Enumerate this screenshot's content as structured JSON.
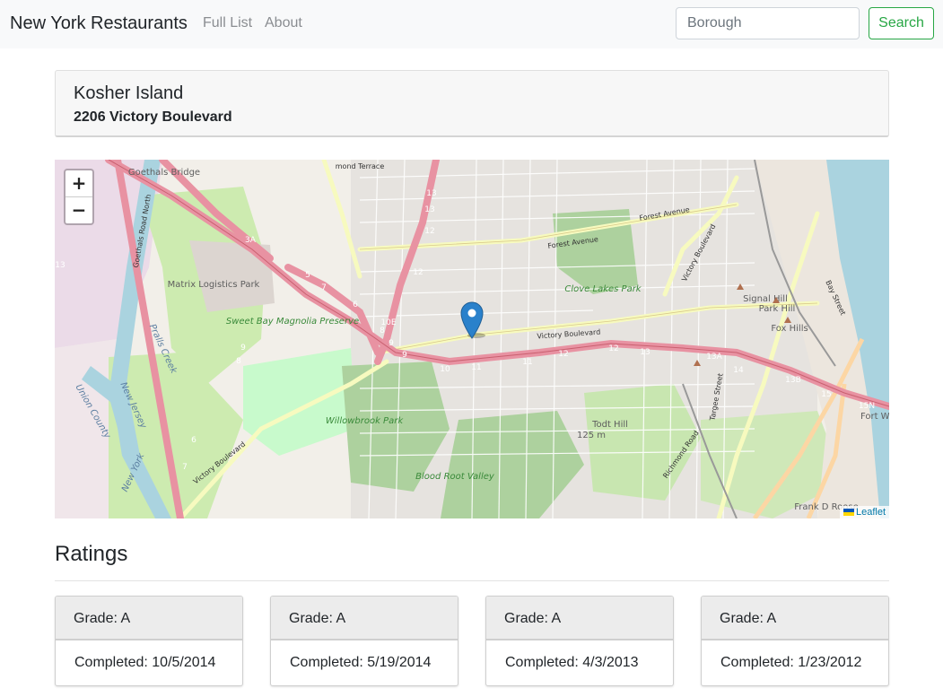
{
  "navbar": {
    "brand": "New York Restaurants",
    "links": [
      "Full List",
      "About"
    ],
    "search": {
      "placeholder": "Borough",
      "value": ""
    },
    "search_button": "Search"
  },
  "restaurant": {
    "name": "Kosher Island",
    "address": "2206 Victory Boulevard"
  },
  "map": {
    "zoom_in": "+",
    "zoom_out": "−",
    "attribution": "Leaflet",
    "labels": {
      "goethals_bridge": "Goethals Bridge",
      "matrix_park": "Matrix Logistics Park",
      "sweet_bay": "Sweet Bay Magnolia Preserve",
      "clove_lakes": "Clove Lakes Park",
      "signal_hill": "Signal Hill",
      "park_hill": "Park Hill",
      "fox_hills": "Fox Hills",
      "willowbrook": "Willowbrook Park",
      "blood_root": "Blood Root Valley",
      "todt_hill": "Todt Hill",
      "todt_hill_elev": "125 m",
      "forest_ave_1": "Forest Avenue",
      "forest_ave_2": "Forest Avenue",
      "victory_blvd_1": "Victory Boulevard",
      "victory_blvd_2": "Victory Boulevard",
      "victory_blvd_3": "Victory Boulevard",
      "richmond_road": "Richmond Road",
      "targee_street": "Targee Street",
      "bay_street": "Bay Street",
      "union_county": "Union County",
      "new_jersey": "New Jersey",
      "new_york": "New York",
      "prall_creek": "Pralls Creek",
      "fort_wa": "Fort Wa",
      "frank_d_roose": "Frank D Roose",
      "hammond_terrace": "mond Terrace",
      "goethals_road": "Goethals Road North"
    },
    "exits": [
      "13",
      "13",
      "12",
      "12",
      "3A",
      "5",
      "6",
      "7",
      "8",
      "9",
      "10E",
      "9",
      "8",
      "9",
      "10",
      "11",
      "11",
      "12",
      "12",
      "13",
      "13A",
      "14",
      "13B",
      "15",
      "15N",
      "7",
      "6",
      "13"
    ]
  },
  "ratings": {
    "title": "Ratings",
    "items": [
      {
        "grade": "Grade: A",
        "completed": "Completed: 10/5/2014"
      },
      {
        "grade": "Grade: A",
        "completed": "Completed: 5/19/2014"
      },
      {
        "grade": "Grade: A",
        "completed": "Completed: 4/3/2013"
      },
      {
        "grade": "Grade: A",
        "completed": "Completed: 1/23/2012"
      }
    ]
  },
  "colors": {
    "navbar_bg": "#f8f9fa",
    "search_green": "#28a745",
    "highway": "#e892a2",
    "primary_road": "#fcd6a4",
    "secondary_road": "#f7fabf",
    "park": "#c8facc",
    "wood": "#add19e",
    "water": "#aad3df",
    "marker_blue": "#2a81cb"
  }
}
